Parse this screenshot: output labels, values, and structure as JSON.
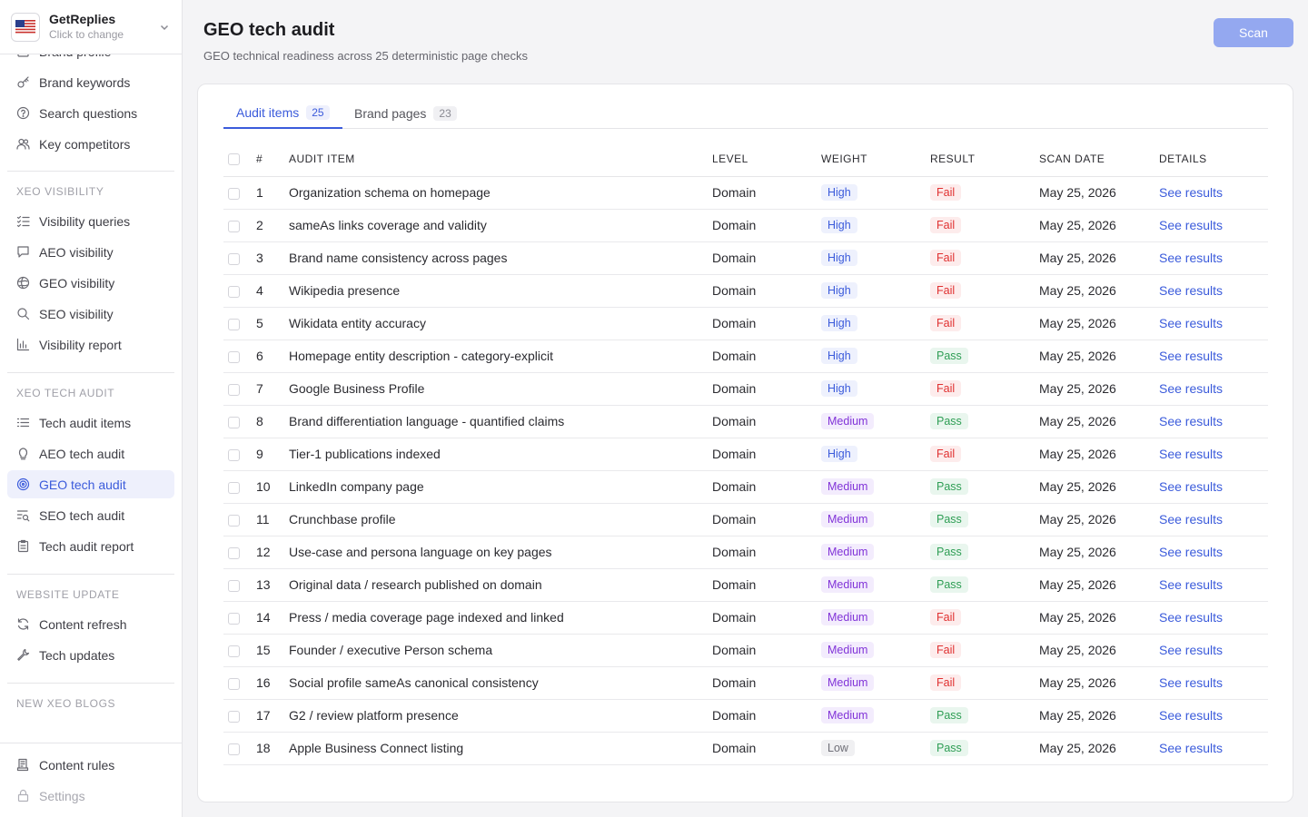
{
  "workspace": {
    "name": "GetReplies",
    "subtitle": "Click to change"
  },
  "sidebar": {
    "partial_item": "Brand profile",
    "top_items": [
      {
        "label": "Brand keywords",
        "icon": "key-icon"
      },
      {
        "label": "Search questions",
        "icon": "question-icon"
      },
      {
        "label": "Key competitors",
        "icon": "users-icon"
      }
    ],
    "sections": [
      {
        "title": "XEO VISIBILITY",
        "items": [
          {
            "label": "Visibility queries",
            "icon": "list-check-icon"
          },
          {
            "label": "AEO visibility",
            "icon": "chat-icon"
          },
          {
            "label": "GEO visibility",
            "icon": "globe-icon"
          },
          {
            "label": "SEO visibility",
            "icon": "search-icon"
          },
          {
            "label": "Visibility report",
            "icon": "bar-chart-icon"
          }
        ]
      },
      {
        "title": "XEO TECH AUDIT",
        "items": [
          {
            "label": "Tech audit items",
            "icon": "list-icon"
          },
          {
            "label": "AEO tech audit",
            "icon": "bulb-icon"
          },
          {
            "label": "GEO tech audit",
            "icon": "target-icon",
            "active": true
          },
          {
            "label": "SEO tech audit",
            "icon": "list-search-icon"
          },
          {
            "label": "Tech audit report",
            "icon": "clipboard-icon"
          }
        ]
      },
      {
        "title": "WEBSITE UPDATE",
        "items": [
          {
            "label": "Content refresh",
            "icon": "refresh-icon"
          },
          {
            "label": "Tech updates",
            "icon": "wrench-icon"
          }
        ]
      },
      {
        "title": "NEW XEO BLOGS",
        "items": []
      }
    ],
    "bottom_items": [
      {
        "label": "Content rules",
        "icon": "rules-icon"
      },
      {
        "label": "Settings",
        "icon": "lock-icon"
      }
    ]
  },
  "header": {
    "title": "GEO tech audit",
    "subtitle": "GEO technical readiness across 25 deterministic page checks",
    "scan_label": "Scan"
  },
  "tabs": [
    {
      "label": "Audit items",
      "count": "25",
      "active": true
    },
    {
      "label": "Brand pages",
      "count": "23",
      "active": false
    }
  ],
  "table": {
    "columns": [
      "#",
      "AUDIT ITEM",
      "LEVEL",
      "WEIGHT",
      "RESULT",
      "SCAN DATE",
      "DETAILS"
    ],
    "rows": [
      {
        "n": "1",
        "item": "Organization schema on homepage",
        "level": "Domain",
        "weight": "High",
        "result": "Fail",
        "date": "May 25, 2026",
        "details": "See results"
      },
      {
        "n": "2",
        "item": "sameAs links coverage and validity",
        "level": "Domain",
        "weight": "High",
        "result": "Fail",
        "date": "May 25, 2026",
        "details": "See results"
      },
      {
        "n": "3",
        "item": "Brand name consistency across pages",
        "level": "Domain",
        "weight": "High",
        "result": "Fail",
        "date": "May 25, 2026",
        "details": "See results"
      },
      {
        "n": "4",
        "item": "Wikipedia presence",
        "level": "Domain",
        "weight": "High",
        "result": "Fail",
        "date": "May 25, 2026",
        "details": "See results"
      },
      {
        "n": "5",
        "item": "Wikidata entity accuracy",
        "level": "Domain",
        "weight": "High",
        "result": "Fail",
        "date": "May 25, 2026",
        "details": "See results"
      },
      {
        "n": "6",
        "item": "Homepage entity description - category-explicit",
        "level": "Domain",
        "weight": "High",
        "result": "Pass",
        "date": "May 25, 2026",
        "details": "See results"
      },
      {
        "n": "7",
        "item": "Google Business Profile",
        "level": "Domain",
        "weight": "High",
        "result": "Fail",
        "date": "May 25, 2026",
        "details": "See results"
      },
      {
        "n": "8",
        "item": "Brand differentiation language - quantified claims",
        "level": "Domain",
        "weight": "Medium",
        "result": "Pass",
        "date": "May 25, 2026",
        "details": "See results"
      },
      {
        "n": "9",
        "item": "Tier-1 publications indexed",
        "level": "Domain",
        "weight": "High",
        "result": "Fail",
        "date": "May 25, 2026",
        "details": "See results"
      },
      {
        "n": "10",
        "item": "LinkedIn company page",
        "level": "Domain",
        "weight": "Medium",
        "result": "Pass",
        "date": "May 25, 2026",
        "details": "See results"
      },
      {
        "n": "11",
        "item": "Crunchbase profile",
        "level": "Domain",
        "weight": "Medium",
        "result": "Pass",
        "date": "May 25, 2026",
        "details": "See results"
      },
      {
        "n": "12",
        "item": "Use-case and persona language on key pages",
        "level": "Domain",
        "weight": "Medium",
        "result": "Pass",
        "date": "May 25, 2026",
        "details": "See results"
      },
      {
        "n": "13",
        "item": "Original data / research published on domain",
        "level": "Domain",
        "weight": "Medium",
        "result": "Pass",
        "date": "May 25, 2026",
        "details": "See results"
      },
      {
        "n": "14",
        "item": "Press / media coverage page indexed and linked",
        "level": "Domain",
        "weight": "Medium",
        "result": "Fail",
        "date": "May 25, 2026",
        "details": "See results"
      },
      {
        "n": "15",
        "item": "Founder / executive Person schema",
        "level": "Domain",
        "weight": "Medium",
        "result": "Fail",
        "date": "May 25, 2026",
        "details": "See results"
      },
      {
        "n": "16",
        "item": "Social profile sameAs canonical consistency",
        "level": "Domain",
        "weight": "Medium",
        "result": "Fail",
        "date": "May 25, 2026",
        "details": "See results"
      },
      {
        "n": "17",
        "item": "G2 / review platform presence",
        "level": "Domain",
        "weight": "Medium",
        "result": "Pass",
        "date": "May 25, 2026",
        "details": "See results"
      },
      {
        "n": "18",
        "item": "Apple Business Connect listing",
        "level": "Domain",
        "weight": "Low",
        "result": "Pass",
        "date": "May 25, 2026",
        "details": "See results"
      }
    ]
  },
  "colors": {
    "accent": "#3b5bdb",
    "scan_button": "#94a8f0",
    "fail": "#e03131",
    "pass": "#2f9e55",
    "medium": "#8133d8"
  }
}
